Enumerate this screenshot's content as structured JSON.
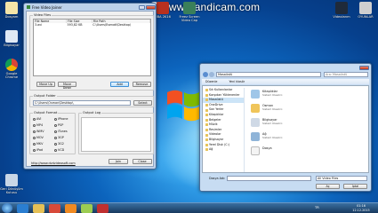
{
  "watermark": {
    "text": "www.Bandicam.com"
  },
  "desktop_icons": [
    {
      "label": "Dosyam",
      "color": "#f4e4a8"
    },
    {
      "label": "Bilgisayar",
      "color": "#dfe9f5"
    },
    {
      "label": "Google Chrome",
      "color": "#e94a3a"
    },
    {
      "label": "Geri Dönüşüm Kutusu",
      "color": "#c8d6e6"
    },
    {
      "label": "NBA 2K16",
      "color": "#b9311f"
    },
    {
      "label": "Freez Screen Video Cap",
      "color": "#3a7f5a"
    },
    {
      "label": "Videolarım",
      "color": "#1f2a3a"
    },
    {
      "label": "OYUNLAR",
      "color": "#cfcfcf"
    },
    {
      "label": "Dosya",
      "color": "#e8e8e8"
    }
  ],
  "joiner": {
    "title": "Free Video Joiner",
    "video_files_label": "Video Files",
    "columns": [
      "File Name",
      "File Size",
      "File Path"
    ],
    "rows": [
      [
        "3.avi",
        "593,82 KB",
        "C:\\Users\\Esenati\\Desktop\\"
      ]
    ],
    "buttons": {
      "move_up": "Move Up",
      "move_down": "Move Down",
      "add": "Add",
      "remove": "Remove",
      "select": "Select",
      "join": "Join",
      "close": "Close"
    },
    "output_folder_label": "Output Folder",
    "output_folder_value": "C:\\Users\\Osman\\Desktop\\",
    "output_format_label": "Output Format",
    "output_log_label": "Output Log",
    "formats": [
      [
        "AVI",
        "iPhone"
      ],
      [
        "MP4",
        "PSP"
      ],
      [
        "WMV",
        "iTunes"
      ],
      [
        "MOV",
        "3GP"
      ],
      [
        "MKV",
        "3G2"
      ],
      [
        "iPad",
        "VCD"
      ]
    ],
    "selected_format": "AVI",
    "link": "http://www.dvdvideosoft.com"
  },
  "explorer": {
    "title": "Masaüstü",
    "address": "Masaüstü",
    "search_placeholder": "Ara: Masaüstü",
    "toolbar": {
      "organize": "Düzenle",
      "new_folder": "Yeni klasör"
    },
    "nav": [
      "Sık Kullanılanlar",
      "Karşıdan Yüklenenler",
      "Masaüstü",
      "OneDrive",
      "Son Yerler",
      "Kitaplıklar",
      "Belgeler",
      "Müzik",
      "Resimler",
      "Videolar",
      "Bilgisayar",
      "Yerel Disk (C:)",
      "Ağ"
    ],
    "items": [
      {
        "name": "Kitaplıklar",
        "sub": "Sistem Klasörü",
        "color": "#9fc6e8"
      },
      {
        "name": "Osman",
        "sub": "Sistem Klasörü",
        "color": "#f0c55a"
      },
      {
        "name": "Bilgisayar",
        "sub": "Sistem Klasörü",
        "color": "#cfd9e6"
      },
      {
        "name": "Ağ",
        "sub": "Sistem Klasörü",
        "color": "#8fb4d8"
      },
      {
        "name": "Dosya",
        "sub": "",
        "color": "#f4f4f4"
      }
    ],
    "filename_label": "Dosya Adı:",
    "filename_value": "",
    "filter": "All Video Files",
    "buttons": {
      "open": "Aç",
      "cancel": "İptal"
    }
  },
  "taskbar": {
    "lang": "TR",
    "time": "01:16",
    "date": "12.12.2015"
  }
}
